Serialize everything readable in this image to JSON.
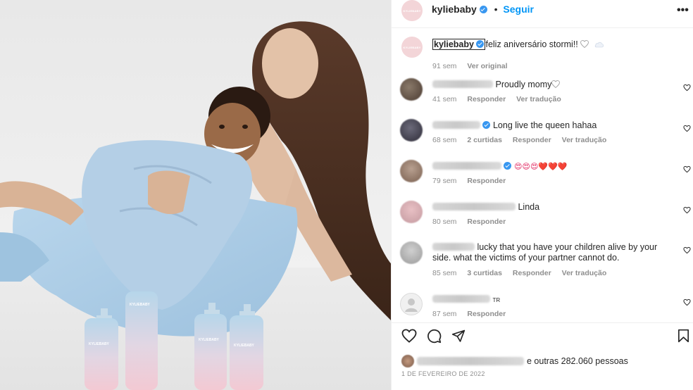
{
  "post": {
    "author": "kyliebaby",
    "follow_label": "Seguir",
    "more_label": "•••",
    "brand_mark": "KYLIEBABY"
  },
  "caption": {
    "user": "kyliebaby",
    "text": "feliz aniversário stormi!! ",
    "time": "91 sem",
    "translate_label": "Ver original"
  },
  "comments": [
    {
      "text": "Proudly momy",
      "time": "41 sem",
      "reply": "Responder",
      "extra": "",
      "translate": "Ver tradução"
    },
    {
      "text": "Long live the queen hahaa",
      "time": "68 sem",
      "reply": "Responder",
      "extra": "2 curtidas",
      "translate": "Ver tradução"
    },
    {
      "text": "😍😍😍❤️❤️❤️",
      "time": "79 sem",
      "reply": "Responder",
      "extra": "",
      "translate": ""
    },
    {
      "text": "Linda",
      "time": "80 sem",
      "reply": "Responder",
      "extra": "",
      "translate": ""
    },
    {
      "text": "lucky that you have your children alive by your side. what the victims of your partner cannot do.",
      "time": "85 sem",
      "reply": "Responder",
      "extra": "3 curtidas",
      "translate": "Ver tradução"
    },
    {
      "text": "TR",
      "time": "87 sem",
      "reply": "Responder",
      "extra": "",
      "translate": ""
    }
  ],
  "likes": {
    "text": "e outras 282.060 pessoas"
  },
  "date": "1 DE FEVEREIRO DE 2022",
  "product_label": "KYLIEBABY",
  "icons": [
    "more-icon",
    "verified-icon",
    "heart-icon",
    "comment-icon",
    "share-icon",
    "bookmark-icon"
  ],
  "colors": {
    "link": "#0095f6",
    "verified": "#3897f0",
    "muted": "#8e8e8e",
    "text": "#262626"
  }
}
